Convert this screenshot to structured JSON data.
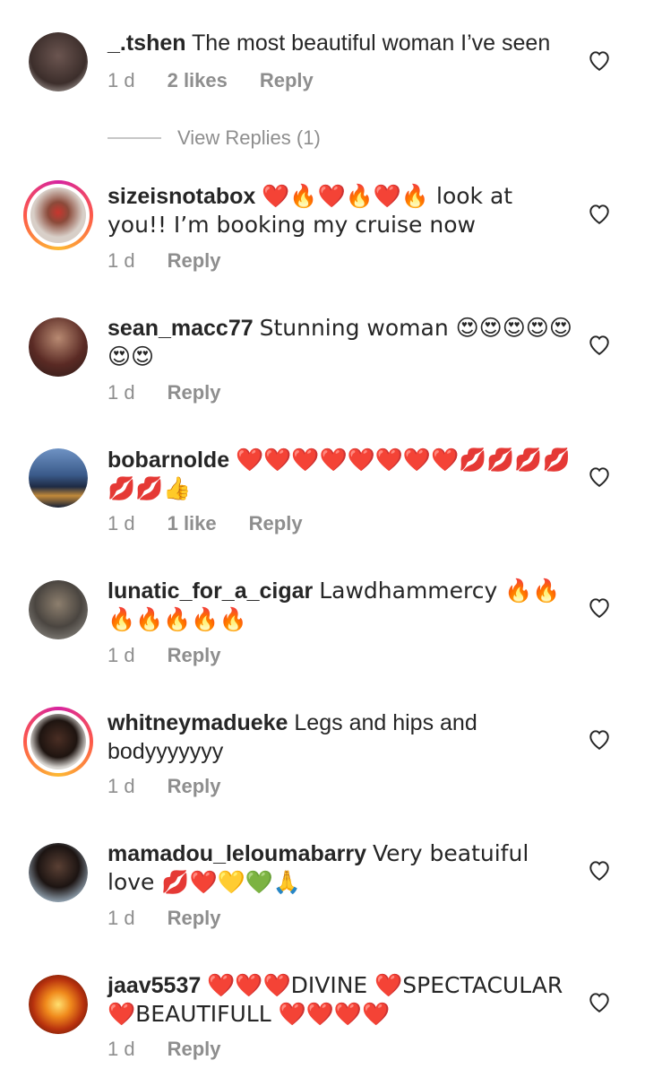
{
  "comments": [
    {
      "username": "_.tshen",
      "text": "The most beautiful woman I’ve seen",
      "time": "1 d",
      "likes": "2 likes",
      "reply": "Reply",
      "avatar_color": "#5a4a48",
      "story": false
    },
    {
      "username": "sizeisnotabox",
      "text": "❤️🔥❤️🔥❤️🔥 look at you!! I’m booking my cruise now",
      "time": "1 d",
      "likes": "",
      "reply": "Reply",
      "avatar_color": "#c9b9ae",
      "story": true
    },
    {
      "username": "sean_macc77",
      "text": "Stunning woman 😍😍😍😍😍😍😍",
      "time": "1 d",
      "likes": "",
      "reply": "Reply",
      "avatar_color": "#7a3a32",
      "story": false
    },
    {
      "username": "bobarnolde",
      "text": "❤️❤️❤️❤️❤️❤️❤️❤️💋💋💋💋💋💋👍",
      "time": "1 d",
      "likes": "1 like",
      "reply": "Reply",
      "avatar_color": "#2d4a7a",
      "story": false
    },
    {
      "username": "lunatic_for_a_cigar",
      "text": "Lawdhammercy 🔥🔥🔥🔥🔥🔥🔥",
      "time": "1 d",
      "likes": "",
      "reply": "Reply",
      "avatar_color": "#6e6c68",
      "story": false
    },
    {
      "username": "whitneymadueke",
      "text": "Legs and hips and bodyyyyyyy",
      "time": "1 d",
      "likes": "",
      "reply": "Reply",
      "avatar_color": "#2b1e1a",
      "story": true
    },
    {
      "username": "mamadou_leloumabarry",
      "text": "Very beatuiful love 💋❤️💛💚🙏",
      "time": "1 d",
      "likes": "",
      "reply": "Reply",
      "avatar_color": "#3a2e28",
      "story": false
    },
    {
      "username": "jaav5537",
      "text": "❤️❤️❤️DIVINE ❤️SPECTACULAR ❤️BEAUTIFULL ❤️❤️❤️❤️",
      "time": "1 d",
      "likes": "",
      "reply": "Reply",
      "avatar_color": "#b8320e",
      "story": false
    }
  ],
  "view_replies": "View Replies (1)",
  "colors": {
    "text": "#262626",
    "meta": "#8e8e8e",
    "ring_start": "#d6249f",
    "ring_end": "#fdb933"
  }
}
